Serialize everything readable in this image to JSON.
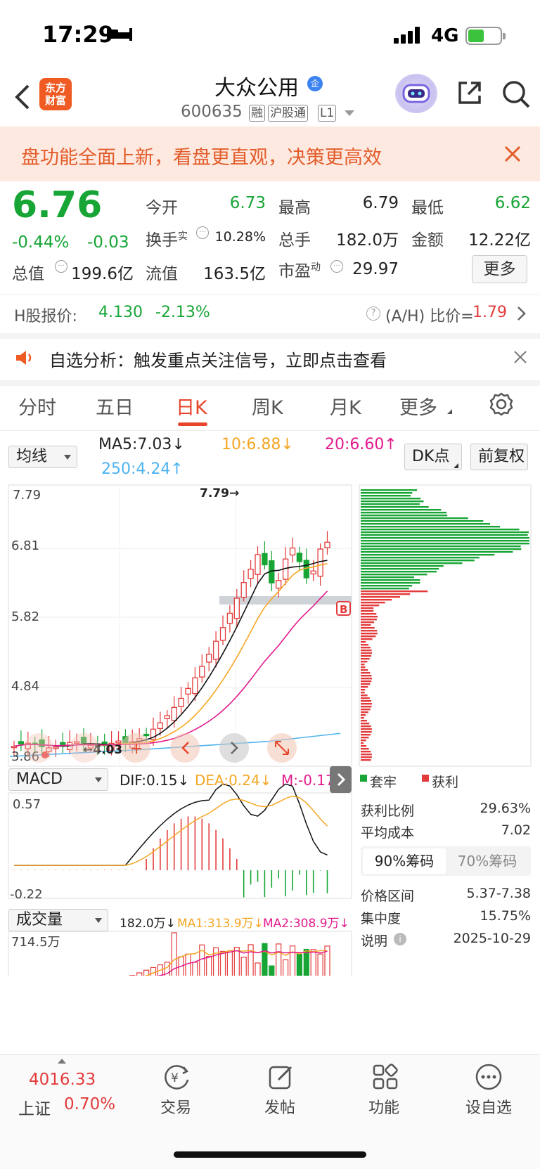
{
  "status": {
    "time": "17:29",
    "network": "4G"
  },
  "header": {
    "logo_text": "东方\n财富",
    "title": "大众公用",
    "title_badge": "企",
    "code": "600635",
    "tags": [
      "融",
      "沪股通",
      "L1"
    ]
  },
  "banner": {
    "text": "盘功能全面上新，看盘更直观，决策更高效"
  },
  "quote": {
    "price": "6.76",
    "change_pct": "-0.44%",
    "change": "-0.03",
    "open_label": "今开",
    "open": "6.73",
    "high_label": "最高",
    "high": "6.79",
    "low_label": "最低",
    "low": "6.62",
    "turnover_label": "换手",
    "turnover_sup": "实",
    "turnover": "10.28%",
    "volume_label": "总手",
    "volume": "182.0万",
    "amount_label": "金额",
    "amount": "12.22亿",
    "mktcap_label": "总值",
    "mktcap": "199.6亿",
    "float_label": "流值",
    "float": "163.5亿",
    "pe_label": "市盈",
    "pe_sup": "动",
    "pe": "29.97",
    "more_label": "更多"
  },
  "h_share": {
    "label": "H股报价:",
    "price": "4.130",
    "change": "-2.13%",
    "ratio_label": "(A/H) 比价=",
    "ratio": "1.79"
  },
  "alert": {
    "text": "自选分析：触发重点关注信号，立即点击查看"
  },
  "tabs": [
    "分时",
    "五日",
    "日K",
    "周K",
    "月K",
    "更多"
  ],
  "active_tab": "日K",
  "ma": {
    "selector": "均线",
    "ma5": "MA5:7.03",
    "ma10": "10:6.88",
    "ma20": "20:6.60",
    "ma250": "250:4.24",
    "dk_label": "DK点",
    "adjust_label": "前复权"
  },
  "kline": {
    "y_labels": [
      "7.79",
      "6.81",
      "5.82",
      "4.84",
      "3.86"
    ],
    "max_marker": "7.79",
    "min_marker": "4.03",
    "b_marker": "B"
  },
  "macd": {
    "selector": "MACD",
    "dif": "DIF:0.15",
    "dea": "DEA:0.24",
    "m": "M:-0.17",
    "y_top": "0.57",
    "y_bottom": "-0.22"
  },
  "volume": {
    "selector": "成交量",
    "vol": "182.0万",
    "ma1": "MA1:313.9万",
    "ma2": "MA2:308.9万",
    "y_top": "714.5万"
  },
  "chips": {
    "legend_trapped": "套牢",
    "legend_profit": "获利",
    "profit_ratio_label": "获利比例",
    "profit_ratio": "29.63%",
    "avg_cost_label": "平均成本",
    "avg_cost": "7.02",
    "tab_90": "90%筹码",
    "tab_70": "70%筹码",
    "range_label": "价格区间",
    "range": "5.37-7.38",
    "concentration_label": "集中度",
    "concentration": "15.75%",
    "note_label": "说明",
    "date": "2025-10-29"
  },
  "bottom": {
    "index_value": "4016.33",
    "index_name": "上证",
    "index_change": "0.70%",
    "trade": "交易",
    "post": "发帖",
    "function": "功能",
    "watchlist": "设自选"
  },
  "colors": {
    "up": "#e33b3b",
    "down": "#17a535",
    "accent": "#e6452a"
  }
}
